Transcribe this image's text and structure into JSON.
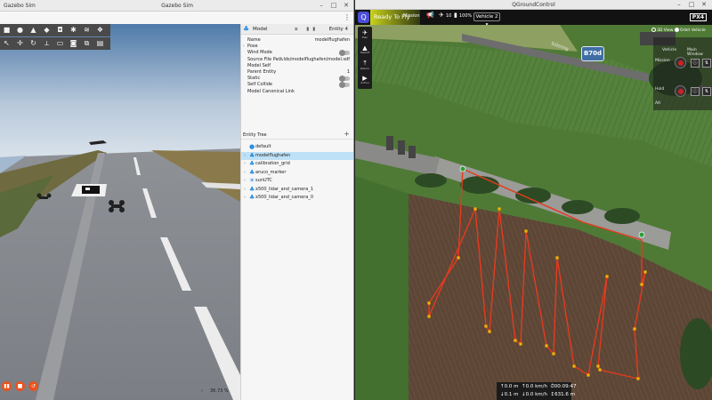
{
  "gazebo": {
    "title_left": "Gazebo Sim",
    "title_center": "Gazebo Sim",
    "win_min": "–",
    "win_max": "□",
    "win_close": "✕",
    "menu_kebab": "⋮",
    "toolbar_row1": [
      "■",
      "●",
      "▲",
      "◆",
      "◘",
      "✱",
      "≋",
      "❖"
    ],
    "toolbar_row2": [
      "↖",
      "✛",
      "↻",
      "⟂",
      "▭",
      "◙",
      "⧉",
      "▤"
    ],
    "play": [
      "▮▮",
      "■",
      "↺"
    ],
    "rtf_arrow": "‹",
    "rtf": "36.73 %",
    "component": {
      "header_icon": "♣",
      "header_name": "Model",
      "header_tools": "⧈ ▮▮",
      "entity": "Entity 4",
      "rows": [
        {
          "key": "Name",
          "value": "modelflughafen"
        },
        {
          "key": "Pose",
          "value": "",
          "arrow": "›"
        },
        {
          "key": "Wind Mode",
          "value": "",
          "toggle": true
        },
        {
          "key": "Source File Path",
          "value": "...lds/modelflughafen/model.sdf"
        },
        {
          "key": "Model Self",
          "value": ""
        },
        {
          "key": "Parent Entity",
          "value": "1"
        },
        {
          "key": "Static",
          "value": "",
          "toggle": true
        },
        {
          "key": "Self Collide",
          "value": "",
          "toggle": true
        },
        {
          "key": "Model Canonical Link",
          "value": ""
        }
      ]
    },
    "tree": {
      "title": "Entity Tree",
      "plus": "+",
      "items": [
        {
          "label": "default",
          "icon": "●",
          "arrow": ""
        },
        {
          "label": "modelflughafen",
          "icon": "♣",
          "arrow": "›",
          "selected": true
        },
        {
          "label": "calibration_grid",
          "icon": "♣",
          "arrow": "›"
        },
        {
          "label": "aruco_marker",
          "icon": "♣",
          "arrow": "›"
        },
        {
          "label": "sunUTC",
          "icon": "☀",
          "arrow": "›"
        },
        {
          "label": "x500_lidar_and_camera_1",
          "icon": "♣",
          "arrow": "›"
        },
        {
          "label": "x500_lidar_and_camera_0",
          "icon": "♣",
          "arrow": "›"
        }
      ]
    }
  },
  "qgc": {
    "title": "QGroundControl",
    "win_min": "–",
    "win_max": "□",
    "win_close": "✕",
    "logo": "Q",
    "ready": "Ready To Fly",
    "mode": "Mission",
    "sats": "10",
    "battery": "100%",
    "vehicle": "Vehicle 2 ▾",
    "px4": "PX4",
    "tools": [
      {
        "icon": "✈",
        "label": "Plan"
      },
      {
        "icon": "▲",
        "label": "Takeoff"
      },
      {
        "icon": "⤒",
        "label": "Return"
      },
      {
        "icon": "▶",
        "label": "Action"
      }
    ],
    "map_type": {
      "opt1": "3D View",
      "opt2": "Orbit Vehicle"
    },
    "label_b70d": "B70d",
    "map_street": "Sülzring",
    "instruments": {
      "top_left": "Vehicle",
      "top_right": "Main Window",
      "mission_label": "Mission",
      "hold_label": "Hold",
      "alt_label": "Alt",
      "btn1": "ⓘ",
      "btn2": "⇅"
    },
    "telemetry": {
      "alt_up": "↑0.0 m",
      "hspeed": "↑0.0 km/h",
      "time": "⏱00:09:47",
      "alt_down": "↓0.1 m",
      "vspeed": "↓0.0 km/h",
      "dist": "↕631.6 m"
    }
  },
  "colors": {
    "mission_line": "#e53a1e",
    "waypoint": "#f4b400",
    "qgc_accent": "#c9d31c",
    "gz_selected": "#bfe1f7",
    "gz_accent": "#e8531f"
  }
}
